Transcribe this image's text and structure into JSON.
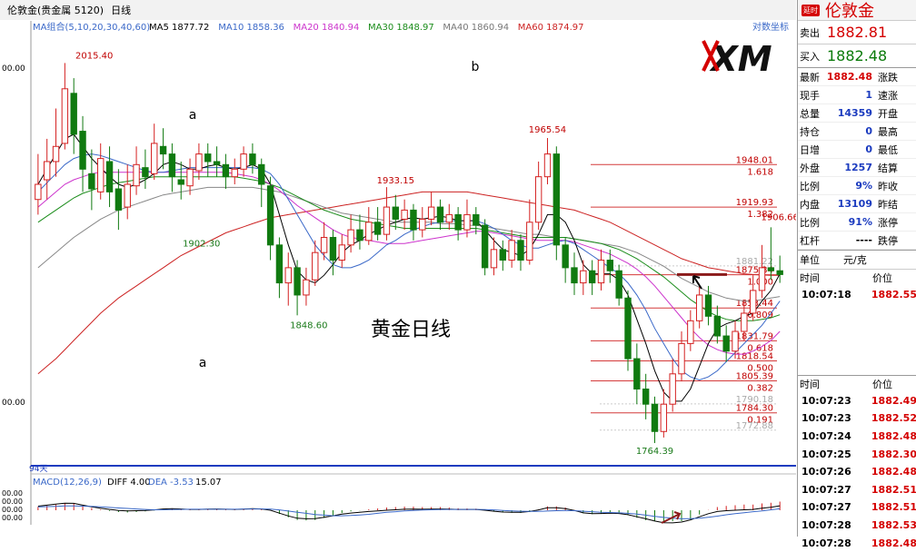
{
  "header": {
    "title": "伦敦金(贵金属 5120)",
    "period": "日线",
    "ma_group_label": "MA组合(5,10,20,30,40,60)",
    "ma_values": [
      {
        "label": "MA5 1877.72",
        "color": "#000000"
      },
      {
        "label": "MA10 1858.36",
        "color": "#3a68c8"
      },
      {
        "label": "MA20 1840.94",
        "color": "#cc33cc"
      },
      {
        "label": "MA30 1848.97",
        "color": "#1a8c1a"
      },
      {
        "label": "MA40 1860.94",
        "color": "#777777"
      },
      {
        "label": "MA60 1874.97",
        "color": "#cc2222"
      }
    ],
    "coord_button": "对数坐标"
  },
  "annotations": {
    "label_a_upper": "a",
    "label_a_lower": "a",
    "label_b": "b",
    "title_text": "黄金日线",
    "logo": "XM",
    "days": "94天",
    "y_edge_top": "00.00",
    "y_edge_mid": "00.00"
  },
  "macd": {
    "label": "MACD(12,26,9)",
    "diff": "DIFF 4.00",
    "dea": "DEA -3.53",
    "macd": "15.07",
    "axis": [
      "00.00",
      "00.00",
      "00.00",
      "00.00"
    ]
  },
  "chart_data": {
    "type": "candlestick",
    "ylim": [
      1750,
      2035
    ],
    "price_labels": [
      {
        "text": "2015.40",
        "value": 2015.4
      },
      {
        "text": "1902.30",
        "value": 1902.3
      },
      {
        "text": "1848.60",
        "value": 1848.6
      },
      {
        "text": "1933.15",
        "value": 1933.15
      },
      {
        "text": "1965.54",
        "value": 1965.54
      },
      {
        "text": "1764.39",
        "value": 1764.39
      },
      {
        "text": "1906.66",
        "value": 1906.66
      }
    ],
    "fib_levels": [
      {
        "price": "1948.01",
        "ratio": "1.618",
        "value": 1948.01
      },
      {
        "price": "1919.93",
        "ratio": "1.382",
        "value": 1919.93
      },
      {
        "price": "1875.34",
        "ratio": "1.000",
        "value": 1875.34
      },
      {
        "price": "1853.44",
        "ratio": "0.809",
        "value": 1853.44
      },
      {
        "price": "1831.79",
        "ratio": "0.618",
        "value": 1831.79
      },
      {
        "price": "1818.54",
        "ratio": "0.500",
        "value": 1818.54
      },
      {
        "price": "1805.39",
        "ratio": "0.382",
        "value": 1805.39
      },
      {
        "price": "1784.30",
        "ratio": "0.191",
        "value": 1784.3
      }
    ],
    "faint_levels": [
      {
        "price": "1881.22",
        "value": 1881.22
      },
      {
        "price": "1790.18",
        "value": 1790.18
      },
      {
        "price": "1772.88",
        "value": 1772.88
      }
    ],
    "current_marker": 1875.5,
    "candles": [
      [
        1925,
        1935,
        1955,
        1915
      ],
      [
        1938,
        1950,
        1965,
        1925
      ],
      [
        1950,
        1960,
        1985,
        1940
      ],
      [
        1962,
        1998,
        2015,
        1958
      ],
      [
        1995,
        1968,
        2005,
        1955
      ],
      [
        1970,
        1945,
        1980,
        1930
      ],
      [
        1942,
        1932,
        1958,
        1918
      ],
      [
        1930,
        1952,
        1962,
        1925
      ],
      [
        1950,
        1930,
        1960,
        1920
      ],
      [
        1932,
        1918,
        1945,
        1905
      ],
      [
        1920,
        1935,
        1948,
        1912
      ],
      [
        1934,
        1948,
        1960,
        1928
      ],
      [
        1946,
        1940,
        1958,
        1932
      ],
      [
        1942,
        1962,
        1975,
        1938
      ],
      [
        1960,
        1955,
        1972,
        1945
      ],
      [
        1955,
        1940,
        1962,
        1930
      ],
      [
        1938,
        1935,
        1950,
        1925
      ],
      [
        1934,
        1945,
        1952,
        1928
      ],
      [
        1944,
        1955,
        1962,
        1938
      ],
      [
        1955,
        1950,
        1962,
        1940
      ],
      [
        1950,
        1948,
        1960,
        1940
      ],
      [
        1948,
        1940,
        1955,
        1932
      ],
      [
        1940,
        1945,
        1952,
        1935
      ],
      [
        1945,
        1955,
        1960,
        1940
      ],
      [
        1955,
        1948,
        1962,
        1942
      ],
      [
        1948,
        1935,
        1952,
        1920
      ],
      [
        1934,
        1895,
        1940,
        1885
      ],
      [
        1895,
        1870,
        1900,
        1860
      ],
      [
        1870,
        1880,
        1890,
        1855
      ],
      [
        1880,
        1862,
        1885,
        1848.6
      ],
      [
        1862,
        1872,
        1880,
        1855
      ],
      [
        1872,
        1890,
        1898,
        1868
      ],
      [
        1890,
        1900,
        1910,
        1885
      ],
      [
        1900,
        1885,
        1905,
        1875
      ],
      [
        1885,
        1895,
        1902,
        1880
      ],
      [
        1895,
        1905,
        1915,
        1890
      ],
      [
        1905,
        1898,
        1915,
        1892
      ],
      [
        1898,
        1910,
        1920,
        1895
      ],
      [
        1910,
        1902,
        1920,
        1898
      ],
      [
        1902,
        1920,
        1933.15,
        1898
      ],
      [
        1920,
        1912,
        1928,
        1905
      ],
      [
        1912,
        1918,
        1925,
        1905
      ],
      [
        1918,
        1905,
        1922,
        1898
      ],
      [
        1905,
        1912,
        1920,
        1900
      ],
      [
        1912,
        1920,
        1930,
        1908
      ],
      [
        1920,
        1910,
        1925,
        1905
      ],
      [
        1910,
        1915,
        1922,
        1905
      ],
      [
        1915,
        1905,
        1920,
        1898
      ],
      [
        1905,
        1915,
        1925,
        1900
      ],
      [
        1915,
        1908,
        1920,
        1902
      ],
      [
        1908,
        1880,
        1912,
        1875
      ],
      [
        1880,
        1892,
        1900,
        1875
      ],
      [
        1892,
        1885,
        1898,
        1878
      ],
      [
        1885,
        1898,
        1905,
        1880
      ],
      [
        1898,
        1885,
        1902,
        1878
      ],
      [
        1885,
        1910,
        1925,
        1882
      ],
      [
        1910,
        1940,
        1950,
        1905
      ],
      [
        1940,
        1955,
        1965.54,
        1935
      ],
      [
        1955,
        1895,
        1960,
        1885
      ],
      [
        1895,
        1880,
        1900,
        1870
      ],
      [
        1880,
        1870,
        1890,
        1862
      ],
      [
        1870,
        1878,
        1885,
        1862
      ],
      [
        1878,
        1870,
        1885,
        1862
      ],
      [
        1870,
        1885,
        1892,
        1865
      ],
      [
        1885,
        1878,
        1892,
        1870
      ],
      [
        1878,
        1860,
        1882,
        1855
      ],
      [
        1860,
        1820,
        1865,
        1812
      ],
      [
        1820,
        1800,
        1830,
        1790
      ],
      [
        1800,
        1790,
        1810,
        1780
      ],
      [
        1790,
        1772,
        1795,
        1764.39
      ],
      [
        1772,
        1790,
        1800,
        1768
      ],
      [
        1790,
        1810,
        1820,
        1785
      ],
      [
        1810,
        1830,
        1838,
        1805
      ],
      [
        1830,
        1845,
        1852,
        1825
      ],
      [
        1845,
        1862,
        1868,
        1840
      ],
      [
        1862,
        1848,
        1868,
        1842
      ],
      [
        1848,
        1835,
        1855,
        1830
      ],
      [
        1835,
        1825,
        1842,
        1818
      ],
      [
        1825,
        1838,
        1845,
        1820
      ],
      [
        1838,
        1850,
        1858,
        1832
      ],
      [
        1850,
        1865,
        1875,
        1845
      ],
      [
        1865,
        1880,
        1895,
        1860
      ],
      [
        1880,
        1878,
        1906.66,
        1872
      ],
      [
        1878,
        1875.5,
        1888,
        1870
      ]
    ],
    "ma5": [
      1935,
      1945,
      1955,
      1965,
      1968,
      1960,
      1952,
      1946,
      1940,
      1935,
      1933,
      1935,
      1938,
      1942,
      1948,
      1950,
      1948,
      1945,
      1945,
      1947,
      1948,
      1946,
      1945,
      1946,
      1948,
      1945,
      1935,
      1915,
      1895,
      1878,
      1872,
      1870,
      1875,
      1882,
      1890,
      1895,
      1898,
      1902,
      1905,
      1908,
      1910,
      1912,
      1913,
      1912,
      1913,
      1914,
      1913,
      1911,
      1911,
      1911,
      1905,
      1898,
      1892,
      1890,
      1888,
      1892,
      1902,
      1915,
      1915,
      1910,
      1898,
      1882,
      1876,
      1876,
      1876,
      1872,
      1862,
      1846,
      1830,
      1812,
      1798,
      1792,
      1792,
      1800,
      1815,
      1830,
      1840,
      1843,
      1845,
      1848,
      1850,
      1858,
      1865,
      1876
    ],
    "ma10": [
      1930,
      1936,
      1942,
      1948,
      1952,
      1954,
      1955,
      1954,
      1952,
      1950,
      1948,
      1946,
      1944,
      1943,
      1943,
      1944,
      1945,
      1946,
      1946,
      1946,
      1946,
      1946,
      1946,
      1946,
      1946,
      1945,
      1942,
      1935,
      1925,
      1915,
      1905,
      1895,
      1888,
      1882,
      1880,
      1880,
      1882,
      1885,
      1890,
      1895,
      1898,
      1902,
      1905,
      1907,
      1909,
      1910,
      1911,
      1911,
      1911,
      1911,
      1909,
      1906,
      1902,
      1898,
      1895,
      1893,
      1893,
      1895,
      1897,
      1898,
      1896,
      1892,
      1888,
      1884,
      1880,
      1876,
      1870,
      1862,
      1852,
      1840,
      1830,
      1820,
      1812,
      1808,
      1806,
      1808,
      1812,
      1818,
      1824,
      1830,
      1836,
      1842,
      1850,
      1858
    ],
    "ma20": [
      1920,
      1925,
      1930,
      1935,
      1938,
      1940,
      1942,
      1943,
      1943,
      1943,
      1943,
      1943,
      1943,
      1943,
      1943,
      1943,
      1943,
      1943,
      1943,
      1943,
      1943,
      1943,
      1942,
      1941,
      1940,
      1938,
      1935,
      1931,
      1926,
      1921,
      1917,
      1913,
      1909,
      1905,
      1902,
      1900,
      1899,
      1898,
      1897,
      1896,
      1896,
      1896,
      1897,
      1898,
      1899,
      1900,
      1901,
      1902,
      1903,
      1904,
      1904,
      1903,
      1902,
      1901,
      1900,
      1899,
      1898,
      1898,
      1898,
      1898,
      1897,
      1895,
      1893,
      1891,
      1889,
      1886,
      1883,
      1879,
      1874,
      1868,
      1861,
      1854,
      1847,
      1840,
      1834,
      1829,
      1826,
      1824,
      1823,
      1823,
      1825,
      1828,
      1832,
      1838
    ],
    "ma30": [
      1910,
      1914,
      1918,
      1922,
      1926,
      1929,
      1931,
      1933,
      1935,
      1936,
      1937,
      1938,
      1939,
      1940,
      1940,
      1940,
      1940,
      1940,
      1940,
      1940,
      1940,
      1940,
      1940,
      1939,
      1938,
      1937,
      1935,
      1933,
      1930,
      1927,
      1924,
      1921,
      1918,
      1916,
      1914,
      1912,
      1911,
      1910,
      1909,
      1908,
      1907,
      1906,
      1906,
      1906,
      1906,
      1906,
      1906,
      1906,
      1906,
      1906,
      1905,
      1904,
      1903,
      1902,
      1901,
      1900,
      1900,
      1900,
      1900,
      1900,
      1899,
      1898,
      1897,
      1896,
      1894,
      1892,
      1889,
      1886,
      1882,
      1878,
      1874,
      1869,
      1864,
      1859,
      1855,
      1851,
      1848,
      1846,
      1845,
      1845,
      1845,
      1846,
      1847,
      1849
    ],
    "ma40": [
      1880,
      1885,
      1890,
      1895,
      1900,
      1904,
      1908,
      1912,
      1915,
      1918,
      1920,
      1922,
      1924,
      1926,
      1928,
      1929,
      1930,
      1931,
      1932,
      1933,
      1933,
      1933,
      1933,
      1933,
      1933,
      1932,
      1931,
      1930,
      1928,
      1926,
      1924,
      1922,
      1920,
      1918,
      1916,
      1915,
      1914,
      1913,
      1912,
      1911,
      1910,
      1910,
      1910,
      1910,
      1910,
      1909,
      1909,
      1909,
      1908,
      1908,
      1907,
      1906,
      1905,
      1904,
      1903,
      1902,
      1902,
      1901,
      1900,
      1900,
      1899,
      1898,
      1897,
      1896,
      1895,
      1894,
      1892,
      1890,
      1887,
      1884,
      1881,
      1877,
      1873,
      1870,
      1867,
      1864,
      1862,
      1860,
      1859,
      1858,
      1858,
      1859,
      1860,
      1861
    ],
    "ma60": [
      1810,
      1815,
      1820,
      1826,
      1832,
      1838,
      1844,
      1850,
      1855,
      1860,
      1864,
      1868,
      1872,
      1876,
      1880,
      1884,
      1888,
      1891,
      1894,
      1897,
      1900,
      1903,
      1905,
      1907,
      1909,
      1911,
      1913,
      1914,
      1915,
      1916,
      1917,
      1918,
      1919,
      1920,
      1921,
      1922,
      1923,
      1924,
      1925,
      1926,
      1927,
      1928,
      1929,
      1930,
      1930,
      1930,
      1930,
      1930,
      1930,
      1929,
      1928,
      1927,
      1926,
      1925,
      1924,
      1923,
      1922,
      1921,
      1920,
      1919,
      1918,
      1916,
      1914,
      1912,
      1910,
      1907,
      1904,
      1901,
      1898,
      1895,
      1892,
      1889,
      1886,
      1884,
      1882,
      1880,
      1879,
      1878,
      1877,
      1876,
      1875.5,
      1875.2,
      1875.0,
      1875.0
    ]
  },
  "sidebar": {
    "name": "伦敦金",
    "badge": "延时",
    "sell_label": "卖出",
    "sell_price": "1882.81",
    "buy_label": "买入",
    "buy_price": "1882.48",
    "stats": [
      {
        "l": "最新",
        "v": "1882.48",
        "r": "涨跌",
        "c": "red"
      },
      {
        "l": "现手",
        "v": "1",
        "r": "速涨",
        "c": "blue"
      },
      {
        "l": "总量",
        "v": "14359",
        "r": "开盘",
        "c": "blue"
      },
      {
        "l": "持仓",
        "v": "0",
        "r": "最高",
        "c": "blue"
      },
      {
        "l": "日增",
        "v": "0",
        "r": "最低",
        "c": "blue"
      },
      {
        "l": "外盘",
        "v": "1257",
        "r": "结算",
        "c": "blue"
      },
      {
        "l": "比例",
        "v": "9%",
        "r": "昨收",
        "c": "blue"
      },
      {
        "l": "内盘",
        "v": "13109",
        "r": "昨结",
        "c": "blue"
      },
      {
        "l": "比例",
        "v": "91%",
        "r": "涨停",
        "c": "blue"
      },
      {
        "l": "杠杆",
        "v": "----",
        "r": "跌停",
        "c": "black"
      }
    ],
    "unit_label": "单位",
    "unit_value": "元/克",
    "time_header": "时间",
    "price_header": "价位",
    "first_tick": {
      "t": "10:07:18",
      "p": "1882.55"
    },
    "time_header2": "时间",
    "price_header2": "价位",
    "ticks": [
      {
        "t": "10:07:23",
        "p": "1882.49"
      },
      {
        "t": "10:07:23",
        "p": "1882.52"
      },
      {
        "t": "10:07:24",
        "p": "1882.48"
      },
      {
        "t": "10:07:25",
        "p": "1882.30"
      },
      {
        "t": "10:07:26",
        "p": "1882.48"
      },
      {
        "t": "10:07:27",
        "p": "1882.51"
      },
      {
        "t": "10:07:27",
        "p": "1882.51"
      },
      {
        "t": "10:07:28",
        "p": "1882.53"
      },
      {
        "t": "10:07:28",
        "p": "1882.48"
      }
    ]
  }
}
